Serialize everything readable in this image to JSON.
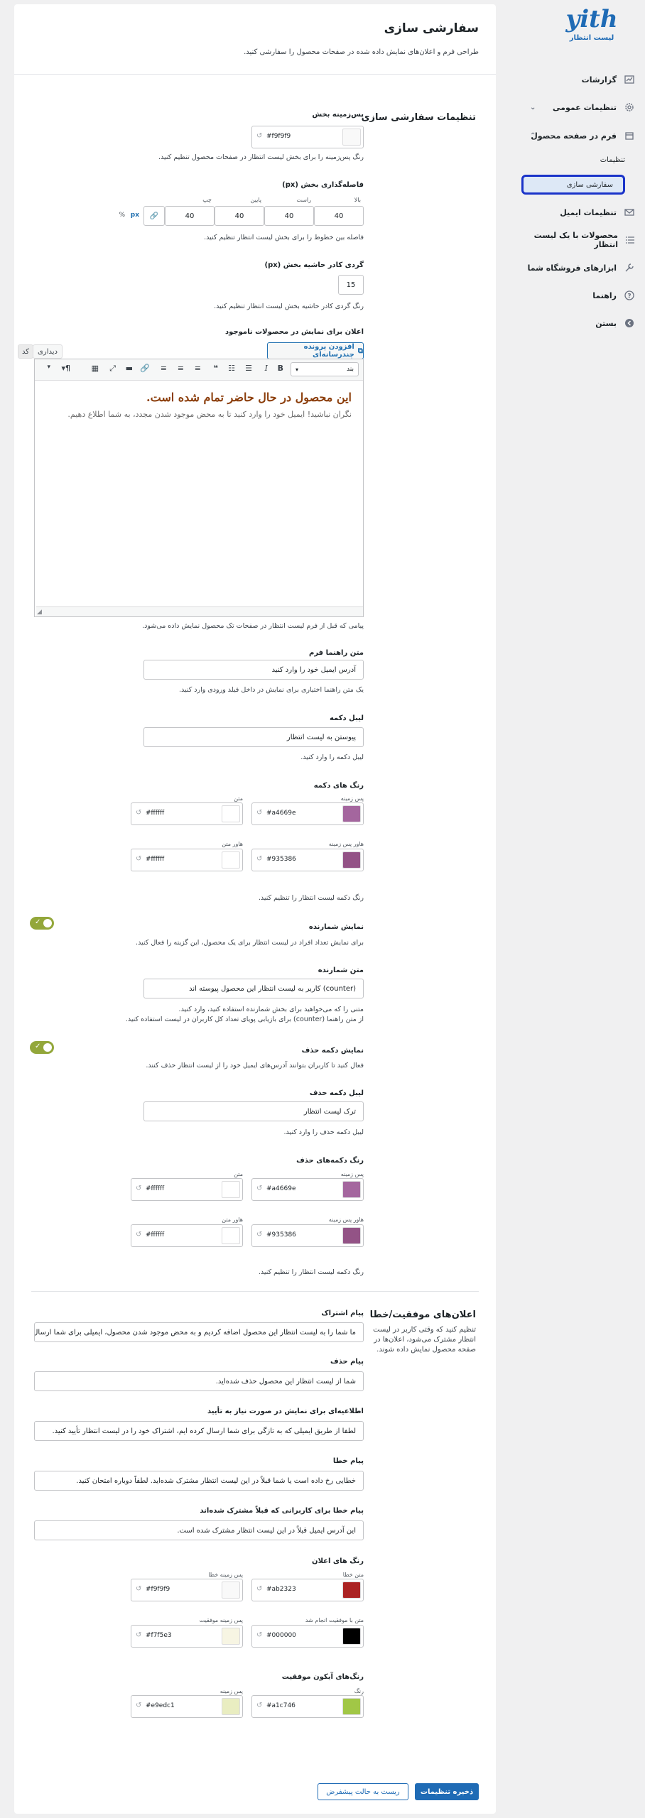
{
  "sidebar": {
    "logo_text": "yith",
    "logo_sub": "لیست انتظار",
    "items": [
      {
        "label": "گزارشات",
        "icon": "chart-icon"
      },
      {
        "label": "تنظیمات عمومی",
        "icon": "gear-icon"
      },
      {
        "label": "فرم در صفحه محصول",
        "icon": "box-icon"
      },
      {
        "label": "تنظیمات ایمیل",
        "icon": "envelope-icon"
      },
      {
        "label": "محصولات با یک لیست انتظار",
        "icon": "list-icon"
      },
      {
        "label": "ابزارهای فروشگاه شما",
        "icon": "tools-icon"
      },
      {
        "label": "راهنما",
        "icon": "help-icon"
      },
      {
        "label": "بستن",
        "icon": "close-circle-icon"
      }
    ],
    "sub_items": [
      "تنظیمات",
      "سفارشی سازی"
    ]
  },
  "page": {
    "title": "سفارشی سازی",
    "description": "طراحی فرم و اعلان‌های نمایش داده شده در صفحات محصول را سفارشی کنید."
  },
  "customization": {
    "title": "تنظیمات سفارشی سازی",
    "section_bg": {
      "label": "پس‌زمینه بخش",
      "hex": "#f9f9f9",
      "desc": "رنگ پس‌زمینه را برای بخش لیست انتظار در صفحات محصول تنظیم کنید."
    },
    "padding": {
      "label": "فاصله‌گذاری بخش (px)",
      "sides": [
        "بالا",
        "راست",
        "پایین",
        "چپ"
      ],
      "values": [
        "40",
        "40",
        "40",
        "40"
      ],
      "unit": "px",
      "percent": "%",
      "desc": "فاصله بین خطوط را برای بخش لیست انتظار تنظیم کنید."
    },
    "radius": {
      "label": "گردی کادر حاشیه بخش (px)",
      "value": "15",
      "desc": "رنگ گردی کادر حاشیه بخش لیست انتظار تنظیم کنید."
    },
    "notice": {
      "label": "اعلان برای نمایش در محصولات ناموجود",
      "add_media": "افزودن پرونده چندرسانه‌ای",
      "tab_visual": "دیداری",
      "tab_code": "کد",
      "format": "بند",
      "heading": "این محصول در حال حاضر تمام شده است.",
      "body": "نگران نباشید! ایمیل خود را وارد کنید تا به محض موجود شدن مجدد، به شما اطلاع دهیم.",
      "desc": "پیامی که قبل از فرم لیست انتظار در صفحات تک محصول نمایش داده می‌شود."
    },
    "placeholder": {
      "label": "متن راهنما فرم",
      "value": "آدرس ایمیل خود را وارد کنید",
      "desc": "یک متن راهنما اختیاری برای نمایش در داخل فیلد ورودی وارد کنید."
    },
    "button_label": {
      "label": "لیبل دکمه",
      "value": "پیوستن به لیست انتظار",
      "desc": "لیبل دکمه را وارد کنید."
    },
    "button_colors": {
      "label": "رنگ های دکمه",
      "bg_label": "پس زمینه",
      "bg": "#a4669e",
      "text_label": "متن",
      "text": "#ffffff",
      "hover_bg_label": "هاور پس زمینه",
      "hover_bg": "#935386",
      "hover_text_label": "هاور متن",
      "hover_text": "#ffffff",
      "bg_text": "#a4669e",
      "hover_bg_text": "#935386",
      "desc": "رنگ دکمه لیست انتظار را تنظیم کنید."
    },
    "show_counter": {
      "label": "نمایش شمارنده",
      "desc": "برای نمایش تعداد افراد در لیست انتظار برای یک محصول، این گزینه را فعال کنید."
    },
    "counter_text": {
      "label": "متن شمارنده",
      "value": "(counter) کاربر به لیست انتظار این محصول پیوسته اند",
      "desc1": "متنی را که می‌خواهید برای بخش شمارنده استفاده کنید، وارد کنید.",
      "desc2": "از متن راهنما (counter) برای بازیابی پویای تعداد کل کاربران در لیست استفاده کنید."
    },
    "show_remove": {
      "label": "نمایش دکمه حذف",
      "desc": "فعال کنید تا کاربران بتوانند آدرس‌های ایمیل خود را از لیست انتظار حذف کنند."
    },
    "remove_label": {
      "label": "لیبل دکمه حذف",
      "value": "ترک لیست انتظار",
      "desc": "لیبل دکمه حذف را وارد کنید."
    },
    "remove_colors": {
      "label": "رنگ دکمه‌های حذف",
      "bg_label": "پس زمینه",
      "bg": "#a4669e",
      "text_label": "متن",
      "text": "#ffffff",
      "hover_bg_label": "هاور پس زمینه",
      "hover_bg": "#935386",
      "hover_text_label": "هاور متن",
      "hover_text": "#ffffff",
      "desc": "رنگ دکمه لیست انتظار را تنظیم کنید."
    }
  },
  "notices": {
    "title": "اعلان‌های موفقیت/خطا",
    "desc": "تنظیم کنید که وقتی کاربر در لیست انتظار مشترک می‌شود، اعلان‌ها در صفحه محصول نمایش داده شوند.",
    "subscribe": {
      "label": "پیام اشتراک",
      "value": "ما شما را به لیست انتظار این محصول اضافه کردیم و به محض موجود شدن محصول، ایمیلی برای شما ارسال خ"
    },
    "remove": {
      "label": "پیام حذف",
      "value": "شما از لیست انتظار این محصول حذف شده‌اید."
    },
    "confirm": {
      "label": "اطلاعیه‌ای برای نمایش در صورت نیاز به تأیید",
      "value": "لطفا از طریق ایمیلی که به تازگی برای شما ارسال کرده ایم، اشتراک خود را در لیست انتظار تأیید کنید."
    },
    "error": {
      "label": "پیام خطا",
      "value": "خطایی رخ داده است یا شما قبلاً در این لیست انتظار مشترک شده‌اید. لطفاً دوباره امتحان کنید."
    },
    "already": {
      "label": "پیام خطا برای کاربرانی که قبلاً مشترک شده‌اند",
      "value": "این آدرس ایمیل قبلاً در این لیست انتظار مشترک شده است."
    },
    "notice_colors": {
      "label": "رنگ های اعلان",
      "error_text_label": "متن خطا",
      "error_text": "#ab2323",
      "error_bg_label": "پس زمینه خطا",
      "error_bg": "#f9f9f9",
      "success_text_label": "متن با موفقیت انجام شد",
      "success_text": "#000000",
      "success_bg_label": "پس زمینه موفقیت",
      "success_bg": "#f7f5e3"
    },
    "success_icon": {
      "label": "رنگ‌های آیکون موفقیت",
      "color_label": "رنگ",
      "color": "#a1c746",
      "bg_label": "پس زمینه",
      "bg": "#e9edc1"
    }
  },
  "buttons": {
    "save": "ذخیره تنظیمات",
    "reset": "ریست به حالت پیشفرض"
  }
}
